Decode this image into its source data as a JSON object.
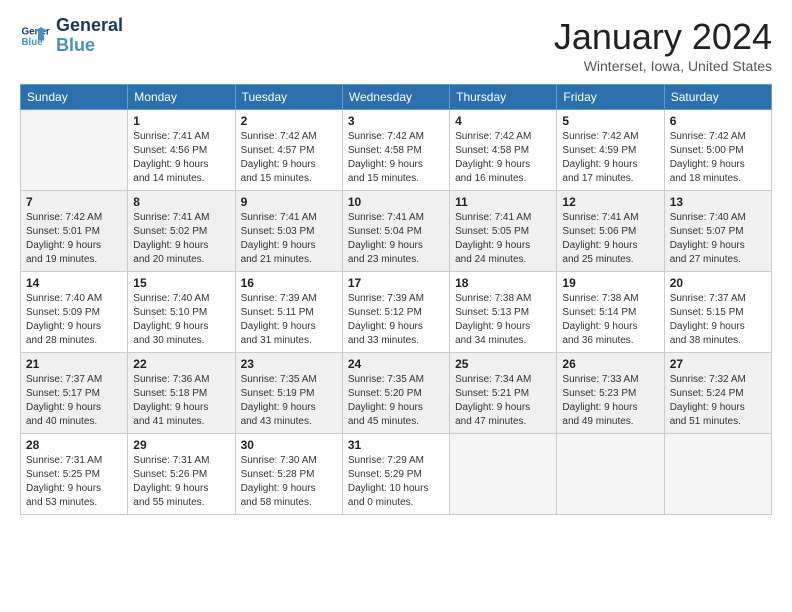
{
  "header": {
    "logo_general": "General",
    "logo_blue": "Blue",
    "month_year": "January 2024",
    "location": "Winterset, Iowa, United States"
  },
  "weekdays": [
    "Sunday",
    "Monday",
    "Tuesday",
    "Wednesday",
    "Thursday",
    "Friday",
    "Saturday"
  ],
  "weeks": [
    [
      {
        "day": "",
        "empty": true
      },
      {
        "day": "1",
        "sunrise": "7:41 AM",
        "sunset": "4:56 PM",
        "daylight": "9 hours and 14 minutes."
      },
      {
        "day": "2",
        "sunrise": "7:42 AM",
        "sunset": "4:57 PM",
        "daylight": "9 hours and 15 minutes."
      },
      {
        "day": "3",
        "sunrise": "7:42 AM",
        "sunset": "4:58 PM",
        "daylight": "9 hours and 15 minutes."
      },
      {
        "day": "4",
        "sunrise": "7:42 AM",
        "sunset": "4:58 PM",
        "daylight": "9 hours and 16 minutes."
      },
      {
        "day": "5",
        "sunrise": "7:42 AM",
        "sunset": "4:59 PM",
        "daylight": "9 hours and 17 minutes."
      },
      {
        "day": "6",
        "sunrise": "7:42 AM",
        "sunset": "5:00 PM",
        "daylight": "9 hours and 18 minutes."
      }
    ],
    [
      {
        "day": "7",
        "sunrise": "7:42 AM",
        "sunset": "5:01 PM",
        "daylight": "9 hours and 19 minutes."
      },
      {
        "day": "8",
        "sunrise": "7:41 AM",
        "sunset": "5:02 PM",
        "daylight": "9 hours and 20 minutes."
      },
      {
        "day": "9",
        "sunrise": "7:41 AM",
        "sunset": "5:03 PM",
        "daylight": "9 hours and 21 minutes."
      },
      {
        "day": "10",
        "sunrise": "7:41 AM",
        "sunset": "5:04 PM",
        "daylight": "9 hours and 23 minutes."
      },
      {
        "day": "11",
        "sunrise": "7:41 AM",
        "sunset": "5:05 PM",
        "daylight": "9 hours and 24 minutes."
      },
      {
        "day": "12",
        "sunrise": "7:41 AM",
        "sunset": "5:06 PM",
        "daylight": "9 hours and 25 minutes."
      },
      {
        "day": "13",
        "sunrise": "7:40 AM",
        "sunset": "5:07 PM",
        "daylight": "9 hours and 27 minutes."
      }
    ],
    [
      {
        "day": "14",
        "sunrise": "7:40 AM",
        "sunset": "5:09 PM",
        "daylight": "9 hours and 28 minutes."
      },
      {
        "day": "15",
        "sunrise": "7:40 AM",
        "sunset": "5:10 PM",
        "daylight": "9 hours and 30 minutes."
      },
      {
        "day": "16",
        "sunrise": "7:39 AM",
        "sunset": "5:11 PM",
        "daylight": "9 hours and 31 minutes."
      },
      {
        "day": "17",
        "sunrise": "7:39 AM",
        "sunset": "5:12 PM",
        "daylight": "9 hours and 33 minutes."
      },
      {
        "day": "18",
        "sunrise": "7:38 AM",
        "sunset": "5:13 PM",
        "daylight": "9 hours and 34 minutes."
      },
      {
        "day": "19",
        "sunrise": "7:38 AM",
        "sunset": "5:14 PM",
        "daylight": "9 hours and 36 minutes."
      },
      {
        "day": "20",
        "sunrise": "7:37 AM",
        "sunset": "5:15 PM",
        "daylight": "9 hours and 38 minutes."
      }
    ],
    [
      {
        "day": "21",
        "sunrise": "7:37 AM",
        "sunset": "5:17 PM",
        "daylight": "9 hours and 40 minutes."
      },
      {
        "day": "22",
        "sunrise": "7:36 AM",
        "sunset": "5:18 PM",
        "daylight": "9 hours and 41 minutes."
      },
      {
        "day": "23",
        "sunrise": "7:35 AM",
        "sunset": "5:19 PM",
        "daylight": "9 hours and 43 minutes."
      },
      {
        "day": "24",
        "sunrise": "7:35 AM",
        "sunset": "5:20 PM",
        "daylight": "9 hours and 45 minutes."
      },
      {
        "day": "25",
        "sunrise": "7:34 AM",
        "sunset": "5:21 PM",
        "daylight": "9 hours and 47 minutes."
      },
      {
        "day": "26",
        "sunrise": "7:33 AM",
        "sunset": "5:23 PM",
        "daylight": "9 hours and 49 minutes."
      },
      {
        "day": "27",
        "sunrise": "7:32 AM",
        "sunset": "5:24 PM",
        "daylight": "9 hours and 51 minutes."
      }
    ],
    [
      {
        "day": "28",
        "sunrise": "7:31 AM",
        "sunset": "5:25 PM",
        "daylight": "9 hours and 53 minutes."
      },
      {
        "day": "29",
        "sunrise": "7:31 AM",
        "sunset": "5:26 PM",
        "daylight": "9 hours and 55 minutes."
      },
      {
        "day": "30",
        "sunrise": "7:30 AM",
        "sunset": "5:28 PM",
        "daylight": "9 hours and 58 minutes."
      },
      {
        "day": "31",
        "sunrise": "7:29 AM",
        "sunset": "5:29 PM",
        "daylight": "10 hours and 0 minutes."
      },
      {
        "day": "",
        "empty": true
      },
      {
        "day": "",
        "empty": true
      },
      {
        "day": "",
        "empty": true
      }
    ]
  ]
}
